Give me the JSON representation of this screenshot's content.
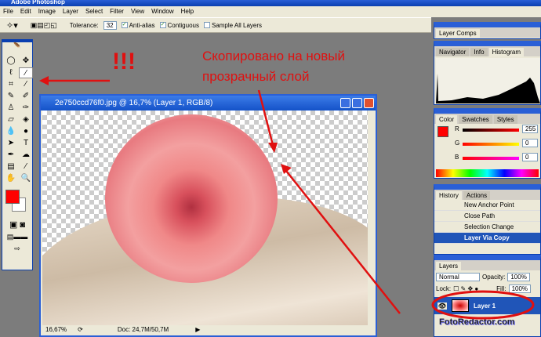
{
  "app": {
    "title": "Adobe Photoshop"
  },
  "menu": [
    "File",
    "Edit",
    "Image",
    "Layer",
    "Select",
    "Filter",
    "View",
    "Window",
    "Help"
  ],
  "options": {
    "tolerance_label": "Tolerance:",
    "tolerance": "32",
    "anti_alias": "Anti-alias",
    "contiguous": "Contiguous",
    "sample_all": "Sample All Layers"
  },
  "document": {
    "title": "2e750ccd76f0.jpg @ 16,7% (Layer 1, RGB/8)",
    "zoom": "16,67%",
    "doc_info": "Doc: 24,7M/50,7M"
  },
  "panels": {
    "layer_comps": "Layer Comps",
    "nav_tabs": [
      "Navigator",
      "Info",
      "Histogram"
    ],
    "color_tabs": [
      "Color",
      "Swatches",
      "Styles"
    ],
    "color": {
      "r_label": "R",
      "g_label": "G",
      "b_label": "B",
      "r": "255",
      "g": "0",
      "b": "0",
      "fg": "#ff0000"
    },
    "history_tabs": [
      "History",
      "Actions"
    ],
    "history": [
      "New Anchor Point",
      "Close Path",
      "Selection Change",
      "Layer Via Copy"
    ],
    "layers_tab": "Layers",
    "blend_mode": "Normal",
    "opacity_label": "Opacity:",
    "opacity": "100%",
    "lock_label": "Lock:",
    "fill_label": "Fill:",
    "fill": "100%",
    "layer_name": "Layer 1"
  },
  "annotations": {
    "exclaim": "!!!",
    "caption_line1": "Скопировано на новый",
    "caption_line2": "прозрачный слой",
    "watermark": "FotoRedactor.com"
  }
}
